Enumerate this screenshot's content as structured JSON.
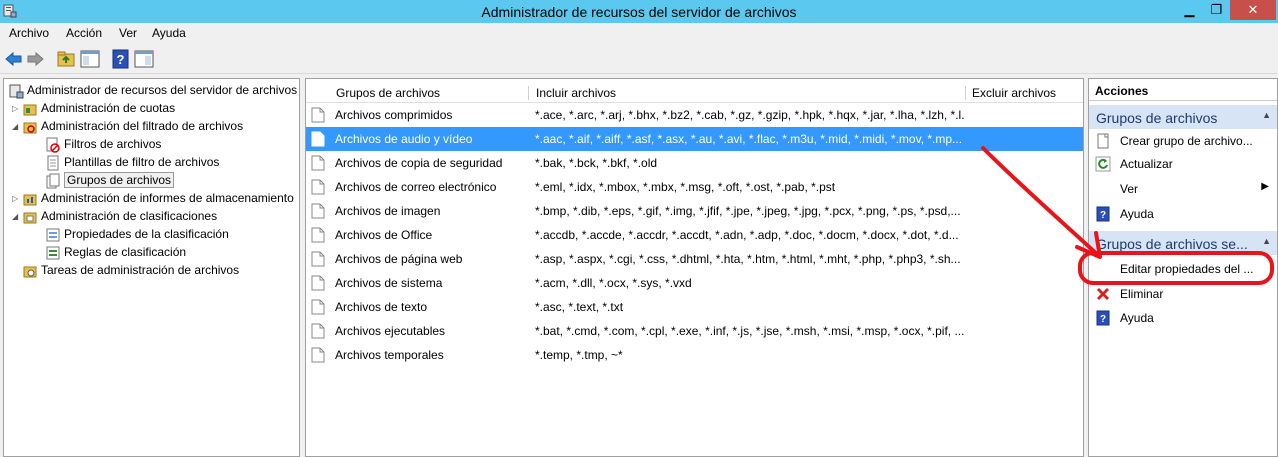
{
  "window": {
    "title": "Administrador de recursos del servidor de archivos",
    "controls": [
      "minimize-icon",
      "maximize-icon",
      "close-icon"
    ]
  },
  "menu": [
    "Archivo",
    "Acción",
    "Ver",
    "Ayuda"
  ],
  "toolbar": [
    "back-arrow-icon",
    "forward-arrow-icon",
    "folder-up-icon",
    "show-hide-tree-icon",
    "help-icon",
    "show-hide-actions-icon"
  ],
  "tree": {
    "root": "Administrador de recursos del servidor de archivos",
    "quota": "Administración de cuotas",
    "screening": "Administración del filtrado de archivos",
    "filters": "Filtros de archivos",
    "templates": "Plantillas de filtro de archivos",
    "groups": "Grupos de archivos",
    "reports": "Administración de informes de almacenamiento",
    "classification": "Administración de clasificaciones",
    "props": "Propiedades de la clasificación",
    "rules": "Reglas de clasificación",
    "tasks": "Tareas de administración de archivos"
  },
  "list": {
    "columns": [
      "Grupos de archivos",
      "Incluir archivos",
      "Excluir archivos"
    ],
    "rows": [
      {
        "name": "Archivos comprimidos",
        "include": "*.ace, *.arc, *.arj, *.bhx, *.bz2, *.cab, *.gz, *.gzip, *.hpk, *.hqx, *.jar, *.lha, *.lzh, *.l...",
        "exclude": ""
      },
      {
        "name": "Archivos de audio y vídeo",
        "include": "*.aac, *.aif, *.aiff, *.asf, *.asx, *.au, *.avi, *.flac, *.m3u, *.mid, *.midi, *.mov, *.mp...",
        "exclude": ""
      },
      {
        "name": "Archivos de copia de seguridad",
        "include": "*.bak, *.bck, *.bkf, *.old",
        "exclude": ""
      },
      {
        "name": "Archivos de correo electrónico",
        "include": "*.eml, *.idx, *.mbox, *.mbx, *.msg, *.oft, *.ost, *.pab, *.pst",
        "exclude": ""
      },
      {
        "name": "Archivos de imagen",
        "include": "*.bmp, *.dib, *.eps, *.gif, *.img, *.jfif, *.jpe, *.jpeg, *.jpg, *.pcx, *.png, *.ps, *.psd,...",
        "exclude": ""
      },
      {
        "name": "Archivos de Office",
        "include": "*.accdb, *.accde, *.accdr, *.accdt, *.adn, *.adp, *.doc, *.docm, *.docx, *.dot, *.d...",
        "exclude": ""
      },
      {
        "name": "Archivos de página web",
        "include": "*.asp, *.aspx, *.cgi, *.css, *.dhtml, *.hta, *.htm, *.html, *.mht, *.php, *.php3, *.sh...",
        "exclude": ""
      },
      {
        "name": "Archivos de sistema",
        "include": "*.acm, *.dll, *.ocx, *.sys, *.vxd",
        "exclude": ""
      },
      {
        "name": "Archivos de texto",
        "include": "*.asc, *.text, *.txt",
        "exclude": ""
      },
      {
        "name": "Archivos ejecutables",
        "include": "*.bat, *.cmd, *.com, *.cpl, *.exe, *.inf, *.js, *.jse, *.msh, *.msi, *.msp, *.ocx, *.pif, ...",
        "exclude": ""
      },
      {
        "name": "Archivos temporales",
        "include": "*.temp, *.tmp, ~*",
        "exclude": ""
      }
    ]
  },
  "actions": {
    "title": "Acciones",
    "section1": "Grupos de archivos",
    "create": "Crear grupo de archivo...",
    "refresh": "Actualizar",
    "view": "Ver",
    "help1": "Ayuda",
    "section2": "Grupos de archivos se...",
    "edit": "Editar propiedades del ...",
    "delete": "Eliminar",
    "help2": "Ayuda"
  },
  "colors": {
    "titlebar": "#5bc8ef",
    "selection": "#3399ff",
    "action_section": "#d6e4f5",
    "annotation": "#e8141b"
  }
}
